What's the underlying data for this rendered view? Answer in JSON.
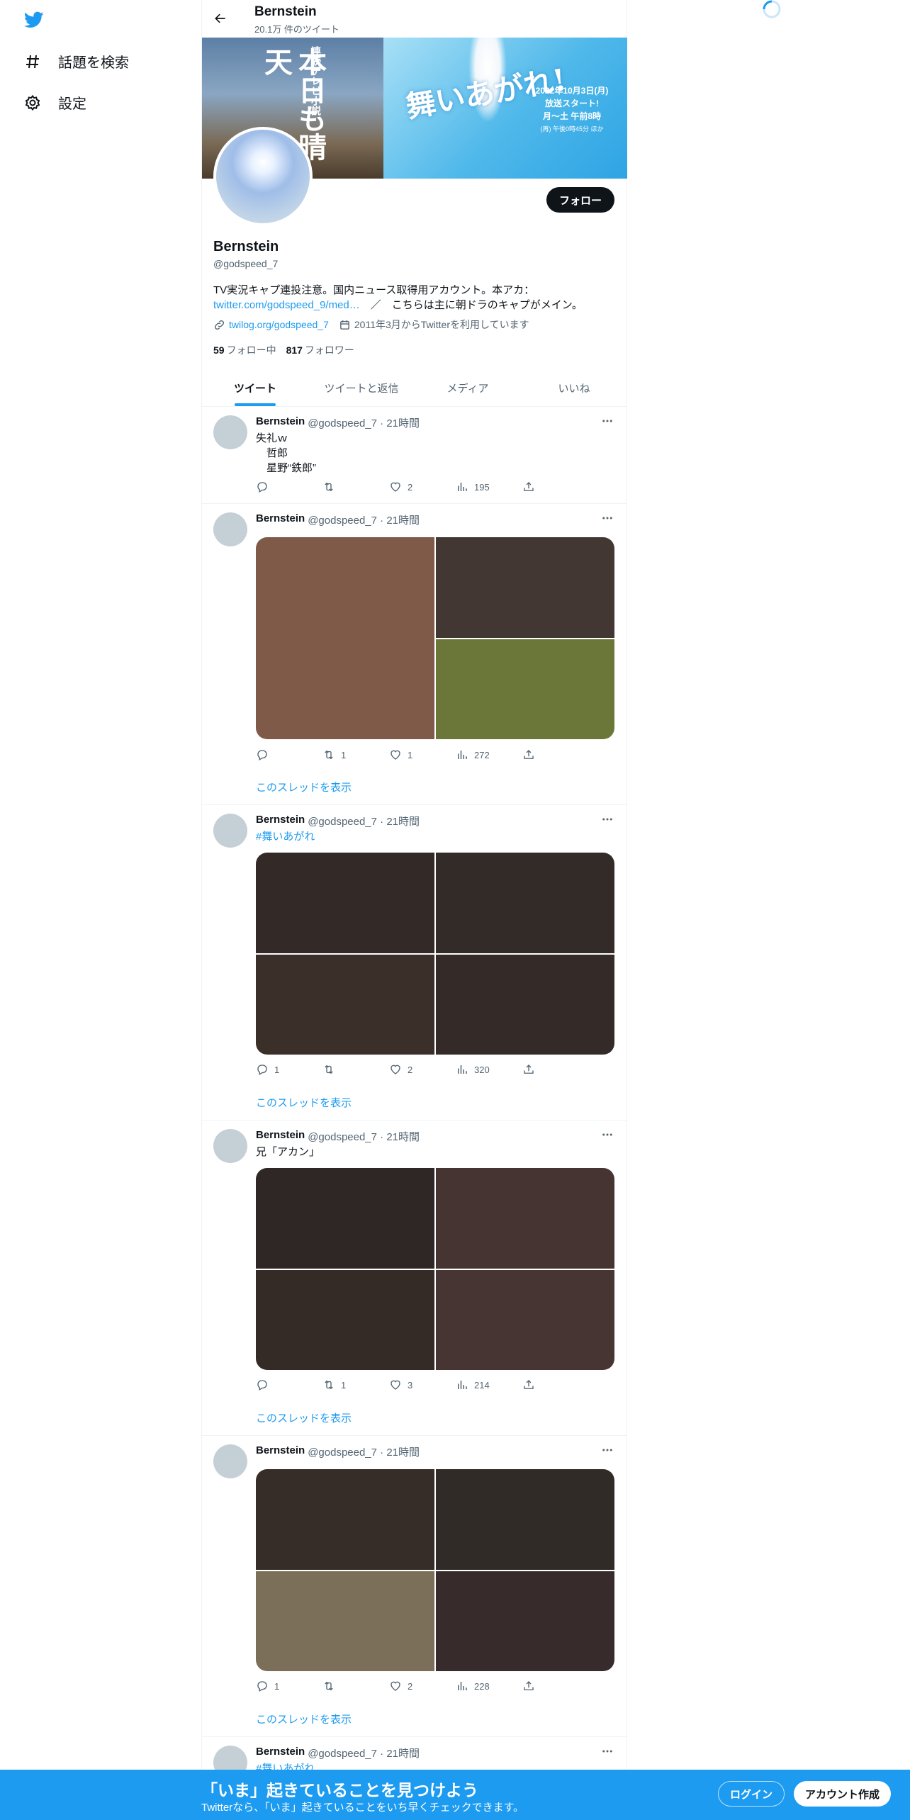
{
  "nav": {
    "items": [
      {
        "label": "話題を検索",
        "icon": "hashtag-icon"
      },
      {
        "label": "設定",
        "icon": "gear-icon"
      }
    ]
  },
  "header": {
    "title": "Bernstein",
    "subtitle": "20.1万 件のツイート"
  },
  "banner": {
    "left_text_small": "連続テレビ小説",
    "left_text_big": "本日も晴天",
    "right_title": "舞いあがれ!",
    "right_date": "2022年10月3日(月)",
    "right_start": "放送スタート!",
    "right_time": "月～土 午前8時",
    "right_time2": "(再) 午後0時45分 ほか"
  },
  "profile": {
    "follow_label": "フォロー",
    "name": "Bernstein",
    "handle": "@godspeed_7",
    "bio_text": "TV実況キャプ連投注意。国内ニュース取得用アカウント。本アカ：",
    "bio_link": "twitter.com/godspeed_9/med…",
    "bio_tail": "　／　こちらは主に朝ドラのキャプがメイン。",
    "website": "twilog.org/godspeed_7",
    "joined": "2011年3月からTwitterを利用しています",
    "following_count": "59",
    "following_label": "フォロー中",
    "followers_count": "817",
    "followers_label": "フォロワー"
  },
  "tabs": [
    "ツイート",
    "ツイートと返信",
    "メディア",
    "いいね"
  ],
  "tweets": [
    {
      "name": "Bernstein",
      "handle": "@godspeed_7 · 21時間",
      "text": "失礼ｗ\n　哲郎\n　星野“鉄郎”",
      "replies": "",
      "retweets": "",
      "likes": "2",
      "views": "195"
    },
    {
      "name": "Bernstein",
      "handle": "@godspeed_7 · 21時間",
      "media_colors": [
        "#7f5a48",
        "#433734",
        "#6b7738"
      ],
      "replies": "",
      "retweets": "1",
      "likes": "1",
      "views": "272",
      "thread": "このスレッドを表示"
    },
    {
      "name": "Bernstein",
      "handle": "@godspeed_7 · 21時間",
      "hashtag": "#舞いあがれ",
      "media_colors": [
        "#332a27",
        "#332b28",
        "#3a2f29",
        "#342a27"
      ],
      "replies": "1",
      "retweets": "",
      "likes": "2",
      "views": "320",
      "thread": "このスレッドを表示"
    },
    {
      "name": "Bernstein",
      "handle": "@godspeed_7 · 21時間",
      "text": "兄「アカン」",
      "media_colors": [
        "#2f2725",
        "#453431",
        "#342a26",
        "#463533"
      ],
      "replies": "",
      "retweets": "1",
      "likes": "3",
      "views": "214",
      "thread": "このスレッドを表示"
    },
    {
      "name": "Bernstein",
      "handle": "@godspeed_7 · 21時間",
      "media_colors": [
        "#362c28",
        "#302b27",
        "#7c6f5a",
        "#372c2b"
      ],
      "replies": "1",
      "retweets": "",
      "likes": "2",
      "views": "228",
      "thread": "このスレッドを表示"
    },
    {
      "name": "Bernstein",
      "handle": "@godspeed_7 · 21時間",
      "hashtag": "#舞いあがれ"
    }
  ],
  "bottom": {
    "title": "「いま」起きていることを見つけよう",
    "subtitle": "Twitterなら、「いま」起きていることをいち早くチェックできます。",
    "login": "ログイン",
    "signup": "アカウント作成"
  },
  "colors": {
    "accent": "#1d9bf0",
    "dark": "#0f1419",
    "muted": "#536471"
  }
}
